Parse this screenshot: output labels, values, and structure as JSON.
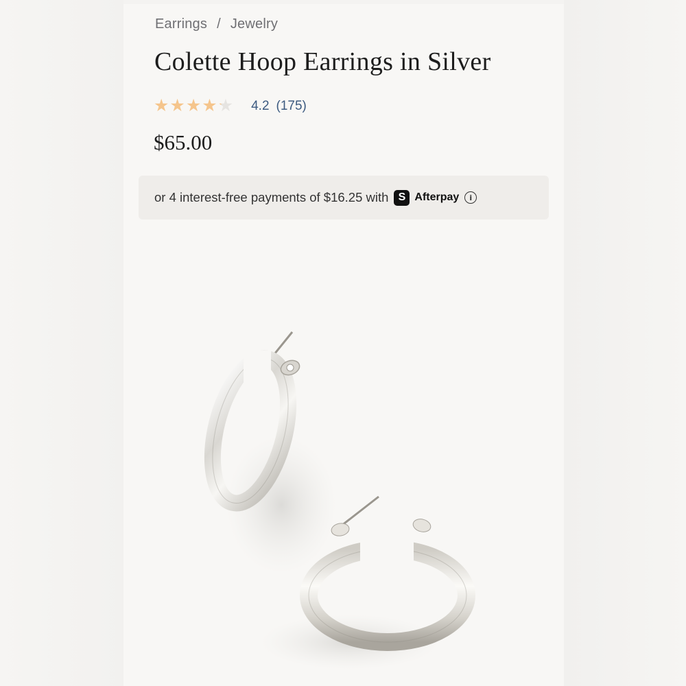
{
  "breadcrumb": {
    "items": [
      "Earrings",
      "Jewelry"
    ],
    "separator": "/"
  },
  "product": {
    "title": "Colette Hoop Earrings in Silver",
    "rating": {
      "value": "4.2",
      "count": "(175)",
      "stars_filled": 4.2,
      "stars_total": 5
    },
    "price": "$65.00"
  },
  "afterpay": {
    "text": "or 4 interest-free payments of $16.25 with",
    "logo_glyph": "S",
    "brand": "Afterpay",
    "info_glyph": "i"
  },
  "image": {
    "subject": "silver-hoop-earrings"
  },
  "colors": {
    "star": "#f5c58c",
    "rating_link": "#3c5a80",
    "background": "#f8f7f5",
    "afterpay_box": "#efedea"
  }
}
